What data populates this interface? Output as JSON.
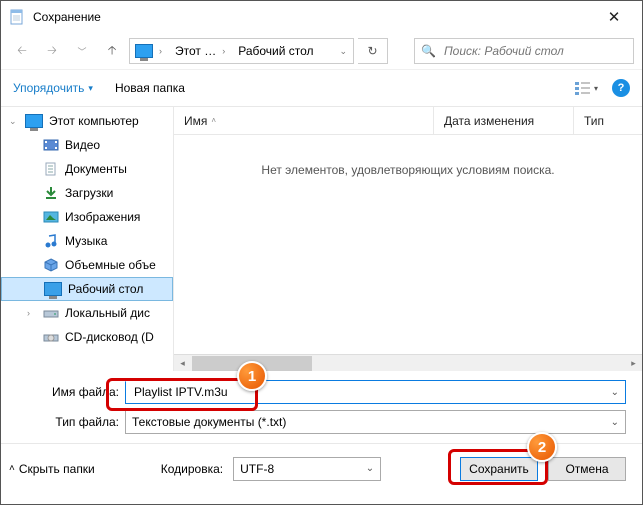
{
  "window": {
    "title": "Сохранение"
  },
  "breadcrumb": {
    "seg1": "Этот …",
    "seg2": "Рабочий стол"
  },
  "search": {
    "placeholder": "Поиск: Рабочий стол"
  },
  "toolbar": {
    "organize": "Упорядочить",
    "newfolder": "Новая папка"
  },
  "tree": {
    "computer": "Этот компьютер",
    "items": [
      "Видео",
      "Документы",
      "Загрузки",
      "Изображения",
      "Музыка",
      "Объемные объе",
      "Рабочий стол",
      "Локальный дис",
      "CD-дисковод (D"
    ]
  },
  "list": {
    "columns": {
      "name": "Имя",
      "date": "Дата изменения",
      "type": "Тип"
    },
    "empty": "Нет элементов, удовлетворяющих условиям поиска."
  },
  "fields": {
    "filename_label": "Имя файла:",
    "filename_value": "Playlist IPTV.m3u",
    "filetype_label": "Тип файла:",
    "filetype_value": "Текстовые документы (*.txt)"
  },
  "bottom": {
    "hidepanels": "Скрыть папки",
    "encoding_label": "Кодировка:",
    "encoding_value": "UTF-8",
    "save": "Сохранить",
    "cancel": "Отмена"
  },
  "annotations": {
    "n1": "1",
    "n2": "2"
  }
}
